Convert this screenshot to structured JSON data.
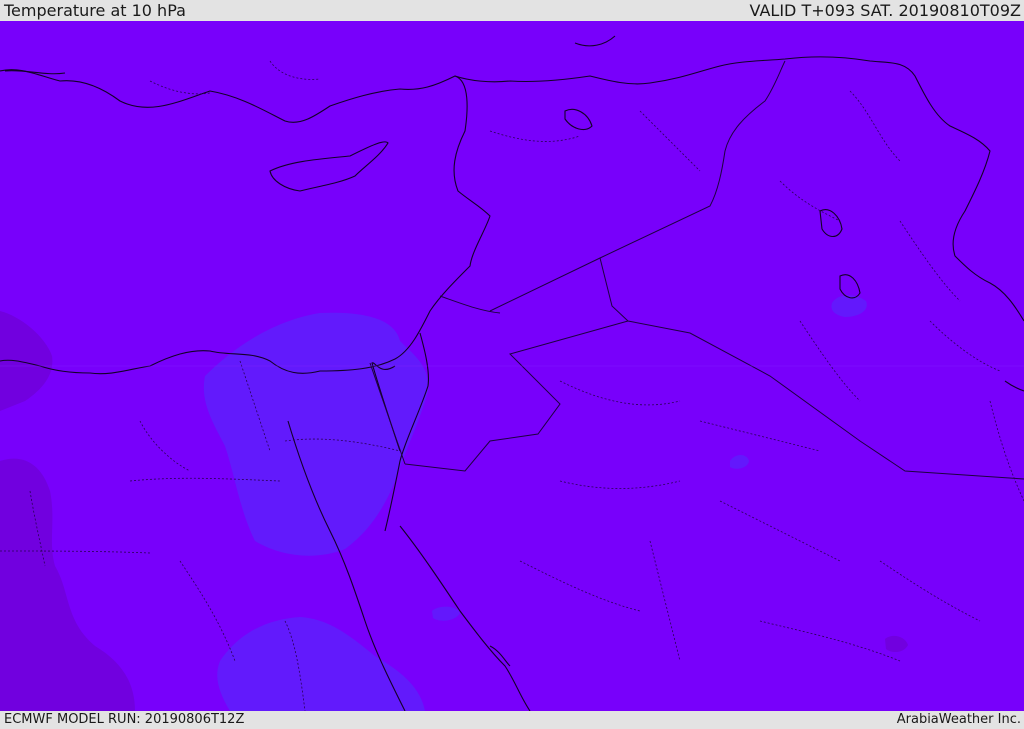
{
  "header": {
    "title": "Temperature at 10 hPa",
    "valid_time": "VALID T+093 SAT. 20190810T09Z"
  },
  "footer": {
    "model_run": "ECMWF MODEL RUN: 20190806T12Z",
    "credit": "ArabiaWeather Inc."
  },
  "map": {
    "field": "temperature",
    "colors": {
      "base": "#7800fb",
      "warm_patch": "#5e1efc",
      "cold_patch": "#7000dc",
      "coastline": "#140028",
      "border": "#1e0040"
    }
  }
}
